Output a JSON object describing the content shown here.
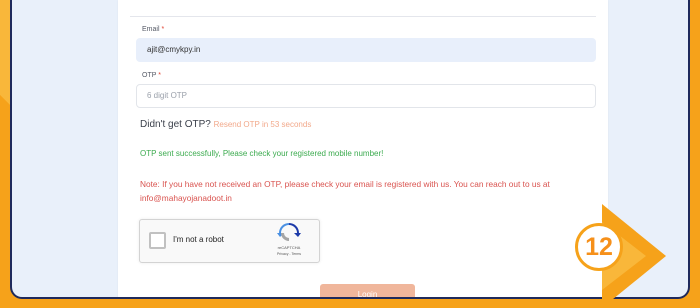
{
  "form": {
    "email_label": "Email",
    "email_value": "ajit@cmykpy.in",
    "otp_label": "OTP",
    "otp_placeholder": "6 digit OTP",
    "required_mark": "*",
    "resend_prompt": "Didn't get OTP?",
    "resend_link": "Resend OTP in 53 seconds",
    "success_message": "OTP sent successfully, Please check your registered mobile number!",
    "note_message": "Note: If you have not received an OTP, please check your email is registered with us. You can reach out to us at info@mahayojanadoot.in",
    "login_label": "Login"
  },
  "captcha": {
    "label": "I'm not a robot",
    "brand": "reCAPTCHA",
    "links": "Privacy - Terms"
  },
  "step_badge": {
    "number": "12"
  },
  "colors": {
    "background": "#f6a21a",
    "panel": "#e9f0fa",
    "panel_border": "#1f2a5c",
    "success": "#3cab4f",
    "note": "#d9534f",
    "login_button": "#f0b69b",
    "resend_link": "#f2a98b"
  },
  "icons": {
    "captcha_logo": "recaptcha-logo-icon",
    "step_arrow": "arrow-right-icon"
  }
}
